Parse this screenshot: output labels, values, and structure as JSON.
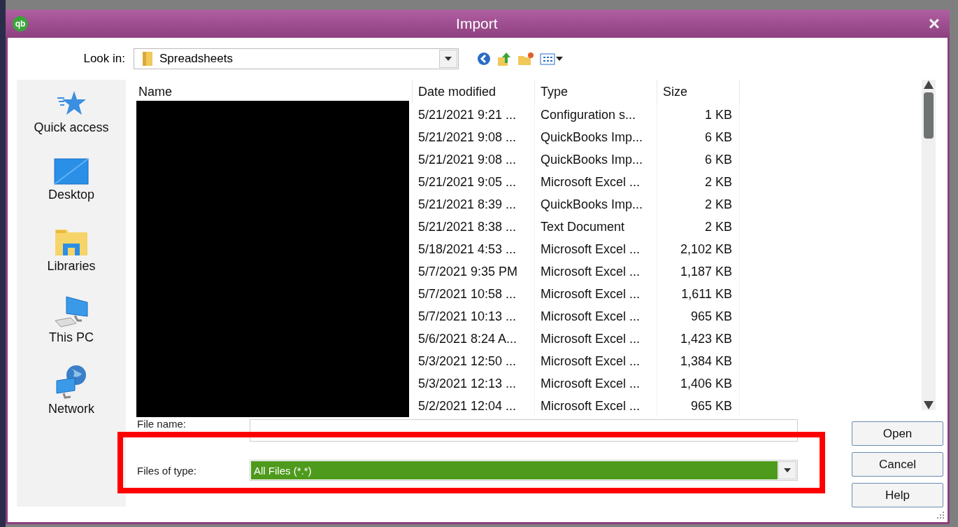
{
  "window": {
    "logo": "qb",
    "title": "Import",
    "close": "×"
  },
  "look_in": {
    "label": "Look in:",
    "value": "Spreadsheets"
  },
  "places": [
    {
      "label": "Quick access",
      "kind": "star"
    },
    {
      "label": "Desktop",
      "kind": "desktop"
    },
    {
      "label": "Libraries",
      "kind": "libraries"
    },
    {
      "label": "This PC",
      "kind": "pc"
    },
    {
      "label": "Network",
      "kind": "network"
    }
  ],
  "file_list": {
    "columns": [
      "Name",
      "Date modified",
      "Type",
      "Size"
    ],
    "rows": [
      {
        "date": "5/21/2021 9:21 ...",
        "type": "Configuration s...",
        "size": "1 KB"
      },
      {
        "date": "5/21/2021 9:08 ...",
        "type": "QuickBooks Imp...",
        "size": "6 KB"
      },
      {
        "date": "5/21/2021 9:08 ...",
        "type": "QuickBooks Imp...",
        "size": "6 KB"
      },
      {
        "date": "5/21/2021 9:05 ...",
        "type": "Microsoft Excel ...",
        "size": "2 KB"
      },
      {
        "date": "5/21/2021 8:39 ...",
        "type": "QuickBooks Imp...",
        "size": "2 KB"
      },
      {
        "date": "5/21/2021 8:38 ...",
        "type": "Text Document",
        "size": "2 KB"
      },
      {
        "date": "5/18/2021 4:53 ...",
        "type": "Microsoft Excel ...",
        "size": "2,102 KB"
      },
      {
        "date": "5/7/2021 9:35 PM",
        "type": "Microsoft Excel ...",
        "size": "1,187 KB"
      },
      {
        "date": "5/7/2021 10:58 ...",
        "type": "Microsoft Excel ...",
        "size": "1,611 KB"
      },
      {
        "date": "5/7/2021 10:13 ...",
        "type": "Microsoft Excel ...",
        "size": "965 KB"
      },
      {
        "date": "5/6/2021 8:24 A...",
        "type": "Microsoft Excel ...",
        "size": "1,423 KB"
      },
      {
        "date": "5/3/2021 12:50 ...",
        "type": "Microsoft Excel ...",
        "size": "1,384 KB"
      },
      {
        "date": "5/3/2021 12:13 ...",
        "type": "Microsoft Excel ...",
        "size": "1,406 KB"
      },
      {
        "date": "5/2/2021 12:04 ...",
        "type": "Microsoft Excel ...",
        "size": "965 KB"
      }
    ]
  },
  "file_name": {
    "label": "File name:"
  },
  "files_of_type": {
    "label": "Files of type:",
    "value": "All Files (*.*)",
    "selected": true
  },
  "buttons": [
    "Open",
    "Cancel",
    "Help"
  ]
}
